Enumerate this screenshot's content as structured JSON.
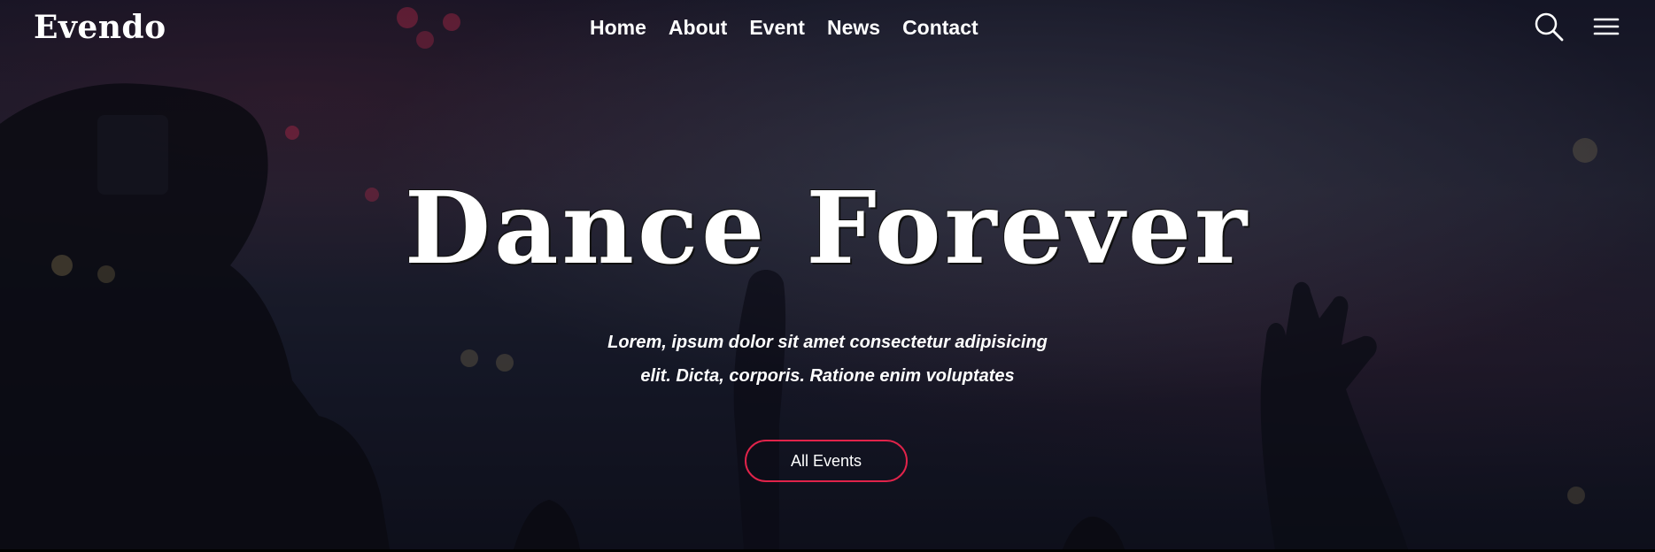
{
  "brand": {
    "name": "Evendo"
  },
  "nav": {
    "items": [
      {
        "label": "Home"
      },
      {
        "label": "About"
      },
      {
        "label": "Event"
      },
      {
        "label": "News"
      },
      {
        "label": "Contact"
      }
    ],
    "search_icon": "search-icon",
    "menu_icon": "hamburger-menu-icon"
  },
  "hero": {
    "title": "Dance Forever",
    "subtitle_line1": "Lorem, ipsum dolor sit amet consectetur adipisicing",
    "subtitle_line2": "elit. Dicta, corporis. Ratione enim voluptates",
    "cta_label": "All Events"
  },
  "colors": {
    "accent": "#e0234a",
    "text": "#ffffff",
    "background": "#1b1c2e"
  }
}
